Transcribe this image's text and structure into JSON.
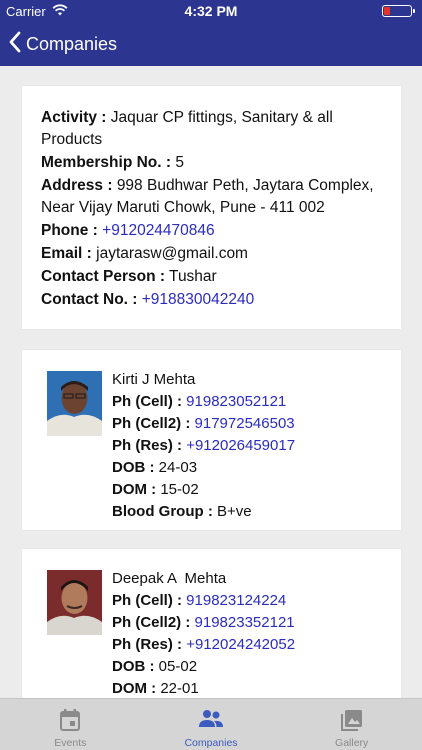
{
  "status_bar": {
    "carrier": "Carrier",
    "time": "4:32 PM"
  },
  "nav": {
    "back_label": "Companies"
  },
  "company": {
    "activity_label": "Activity :",
    "activity_value": "Jaquar CP fittings, Sanitary & all Products",
    "membership_label": "Membership No. :",
    "membership_value": "5",
    "address_label": "Address :",
    "address_value": "998 Budhwar Peth, Jaytara Complex, Near Vijay Maruti Chowk, Pune - 411 002",
    "phone_label": "Phone :",
    "phone_value": "+912024470846",
    "email_label": "Email :",
    "email_value": "jaytarasw@gmail.com",
    "contact_person_label": "Contact Person :",
    "contact_person_value": "Tushar",
    "contact_no_label": "Contact No. :",
    "contact_no_value": "+918830042240"
  },
  "people": [
    {
      "name": "Kirti J Mehta",
      "cell_label": "Ph (Cell) :",
      "cell": "919823052121",
      "cell2_label": "Ph (Cell2) :",
      "cell2": "917972546503",
      "res_label": "Ph (Res) :",
      "res": "+912026459017",
      "dob_label": "DOB :",
      "dob": "24-03",
      "dom_label": "DOM :",
      "dom": "15-02",
      "blood_label": "Blood Group :",
      "blood": "B+ve"
    },
    {
      "name": "Deepak A  Mehta",
      "cell_label": "Ph (Cell) :",
      "cell": "919823124224",
      "cell2_label": "Ph (Cell2) :",
      "cell2": "919823352121",
      "res_label": "Ph (Res) :",
      "res": "+912024242052",
      "dob_label": "DOB :",
      "dob": "05-02",
      "dom_label": "DOM :",
      "dom": "22-01"
    }
  ],
  "tabs": [
    {
      "label": "Events",
      "icon": "calendar-icon",
      "active": false
    },
    {
      "label": "Companies",
      "icon": "people-icon",
      "active": true
    },
    {
      "label": "Gallery",
      "icon": "gallery-icon",
      "active": false
    }
  ],
  "colors": {
    "nav_bg": "#2c3590",
    "link": "#2b2bc0",
    "active_tab": "#3c5bbf",
    "inactive_tab": "#8a8a8a",
    "tabbar_bg": "#d5d5d5"
  }
}
